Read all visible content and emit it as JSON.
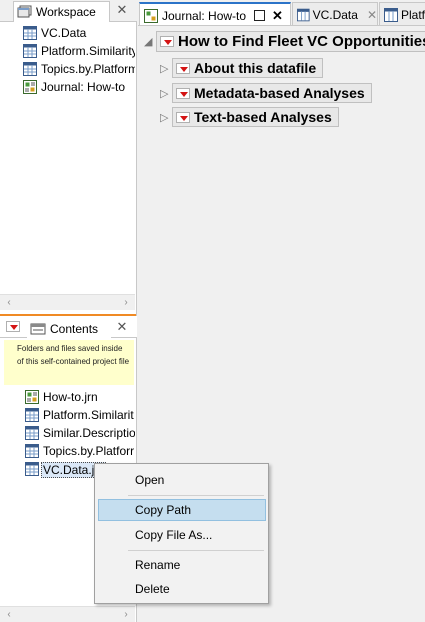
{
  "workspace": {
    "tab_label": "Workspace",
    "items": [
      {
        "label": "VC.Data",
        "icon": "data-table-icon"
      },
      {
        "label": "Platform.Similarity",
        "icon": "data-table-icon"
      },
      {
        "label": "Topics.by.Platform",
        "icon": "data-table-icon"
      },
      {
        "label": "Journal: How-to",
        "icon": "journal-icon"
      }
    ]
  },
  "contents": {
    "tab_label": "Contents",
    "note": "Folders and files saved inside of this self-contained project file",
    "items": [
      {
        "label": "How-to.jrn",
        "icon": "journal-icon"
      },
      {
        "label": "Platform.Similarit",
        "icon": "data-table-icon"
      },
      {
        "label": "Similar.Descriptio",
        "icon": "data-table-icon"
      },
      {
        "label": "Topics.by.Platforr",
        "icon": "data-table-icon"
      },
      {
        "label": "VC.Data.jm",
        "icon": "data-table-icon"
      }
    ]
  },
  "doc_tabs": [
    {
      "label": "Journal: How-to",
      "active": true
    },
    {
      "label": "VC.Data",
      "active": false
    },
    {
      "label": "Platf",
      "active": false
    }
  ],
  "journal": {
    "title": "How to Find Fleet VC Opportunities",
    "sections": [
      "About this datafile",
      "Metadata-based Analyses",
      "Text-based Analyses"
    ]
  },
  "context_menu": {
    "items": [
      "Open",
      "Copy Path",
      "Copy File As...",
      "Rename",
      "Delete"
    ],
    "hovered": "Copy Path"
  },
  "colors": {
    "accent": "#2b73c8",
    "red_triangle": "#d41414",
    "note_bg": "#ffffcc",
    "menu_hover": "#c5deef"
  }
}
